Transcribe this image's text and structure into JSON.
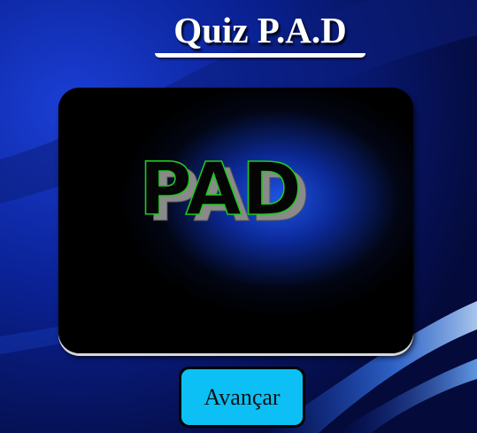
{
  "header": {
    "title": "Quiz P.A.D"
  },
  "image": {
    "logo_text": "PAD",
    "icon": "pad-logo-image"
  },
  "actions": {
    "next_label": "Avançar"
  },
  "colors": {
    "background": "#0a1f9a",
    "button": "#0cc0f5",
    "logo_outline": "#1ec81e",
    "title": "#ffffff"
  }
}
